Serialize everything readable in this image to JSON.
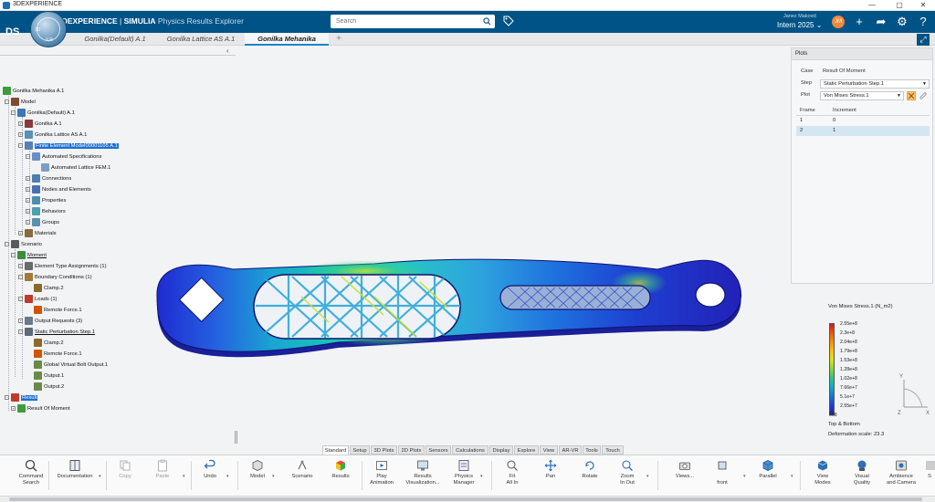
{
  "window": {
    "title": "3DEXPERIENCE",
    "minimize": "—",
    "maximize": "▢",
    "close": "✕"
  },
  "header": {
    "brand_bold": "3D",
    "brand_rest": "EXPERIENCE",
    "brand_sep": " | ",
    "brand_company": "SIMULIA",
    "brand_app": " Physics Results Explorer",
    "search_placeholder": "Search",
    "user_name": "Janez Makovič",
    "user_role": "Intern 2025",
    "avatar_initials": "JM",
    "compass_v": "V,R",
    "compass_3d": "3D"
  },
  "doc_tabs": [
    {
      "label": "Gonilka(Default) A.1",
      "active": false
    },
    {
      "label": "Gonilka Lattice AS A.1",
      "active": false
    },
    {
      "label": "Gonilka Mehanika",
      "active": true
    }
  ],
  "add_tab": "+",
  "tree": [
    {
      "label": "Gonilka Mehanika A.1"
    },
    {
      "label": "Model"
    },
    {
      "label": "Gonilka(Default) A.1"
    },
    {
      "label": "Gonilka A.1"
    },
    {
      "label": "Gonilka Lattice AS A.1"
    },
    {
      "label": "Finite Element Model00001105 A.1"
    },
    {
      "label": "Automated Specifications"
    },
    {
      "label": "Automated Lattice FEM.1"
    },
    {
      "label": "Connections"
    },
    {
      "label": "Nodes and Elements"
    },
    {
      "label": "Properties"
    },
    {
      "label": "Behaviors"
    },
    {
      "label": "Groups"
    },
    {
      "label": "Materials"
    },
    {
      "label": "Scenario"
    },
    {
      "label": "Moment"
    },
    {
      "label": "Element Type Assignments (1)"
    },
    {
      "label": "Boundary Conditions (1)"
    },
    {
      "label": "Clamp.2"
    },
    {
      "label": "Loads (1)"
    },
    {
      "label": "Remote Force.1"
    },
    {
      "label": "Output Requests (3)"
    },
    {
      "label": "Static Perturbation Step.1"
    },
    {
      "label": "Clamp.2"
    },
    {
      "label": "Remote Force.1"
    },
    {
      "label": "Global Virtual Bolt Output.1"
    },
    {
      "label": "Output.1"
    },
    {
      "label": "Output.2"
    },
    {
      "label": "Result"
    },
    {
      "label": "Result Of Moment"
    }
  ],
  "plots_panel": {
    "title": "Plots",
    "case_label": "Case",
    "case_value": "Result Of Moment",
    "step_label": "Step",
    "step_value": "Static Perturbation Step.1",
    "plot_label": "Plot",
    "plot_value": "Von Mises Stress.1",
    "frame_header": "Frame",
    "increment_header": "Increment",
    "rows": [
      {
        "frame": "1",
        "increment": "0"
      },
      {
        "frame": "2",
        "increment": "1"
      }
    ]
  },
  "legend": {
    "title": "Von Mises Stress.1 (N_m2)",
    "ticks": [
      "2.55e+8",
      "2.3e+8",
      "2.04e+8",
      "1.79e+8",
      "1.53e+8",
      "1.28e+8",
      "1.02e+8",
      "7.66e+7",
      "5.1e+7",
      "2.55e+7",
      "588"
    ],
    "footer1": "Top & Bottom",
    "footer2": "Deformation scale: 23.3",
    "colors": [
      "#d7191c",
      "#f98e09",
      "#d9e21b",
      "#2fc38a",
      "#1475d9",
      "#241ba8"
    ]
  },
  "triad": {
    "y": "Y",
    "x": "X",
    "z": "Z"
  },
  "section_tabs": [
    "Standard",
    "Setup",
    "3D Plots",
    "2D Plots",
    "Sensors",
    "Calculations",
    "Display",
    "Explore",
    "View",
    "AR-VR",
    "Tools",
    "Touch"
  ],
  "active_section": "Standard",
  "actions": {
    "command_search": "Command\nSearch",
    "documentation": "Documentation",
    "copy": "Copy",
    "paste": "Paste",
    "undo": "Undo",
    "model": "Model",
    "scenario": "Scenario",
    "results": "Results",
    "play_animation": "Play\nAnimation",
    "results_visualization": "Results\nVisualization...",
    "physics_manager": "Physics\nManager",
    "fit_all_in": "Fit\nAll In",
    "pan": "Pan",
    "rotate": "Rotate",
    "zoom_in_out": "Zoom\nIn Out",
    "views": "Views...",
    "front": "\nfront",
    "parallel": "Parallel",
    "view_modes": "View\nModes",
    "visual_quality": "Visual\nQuality",
    "ambience_camera": "Ambience\nand Camera",
    "s_more": "S"
  },
  "brand_color": "#005386",
  "accent_color": "#1b84c7"
}
